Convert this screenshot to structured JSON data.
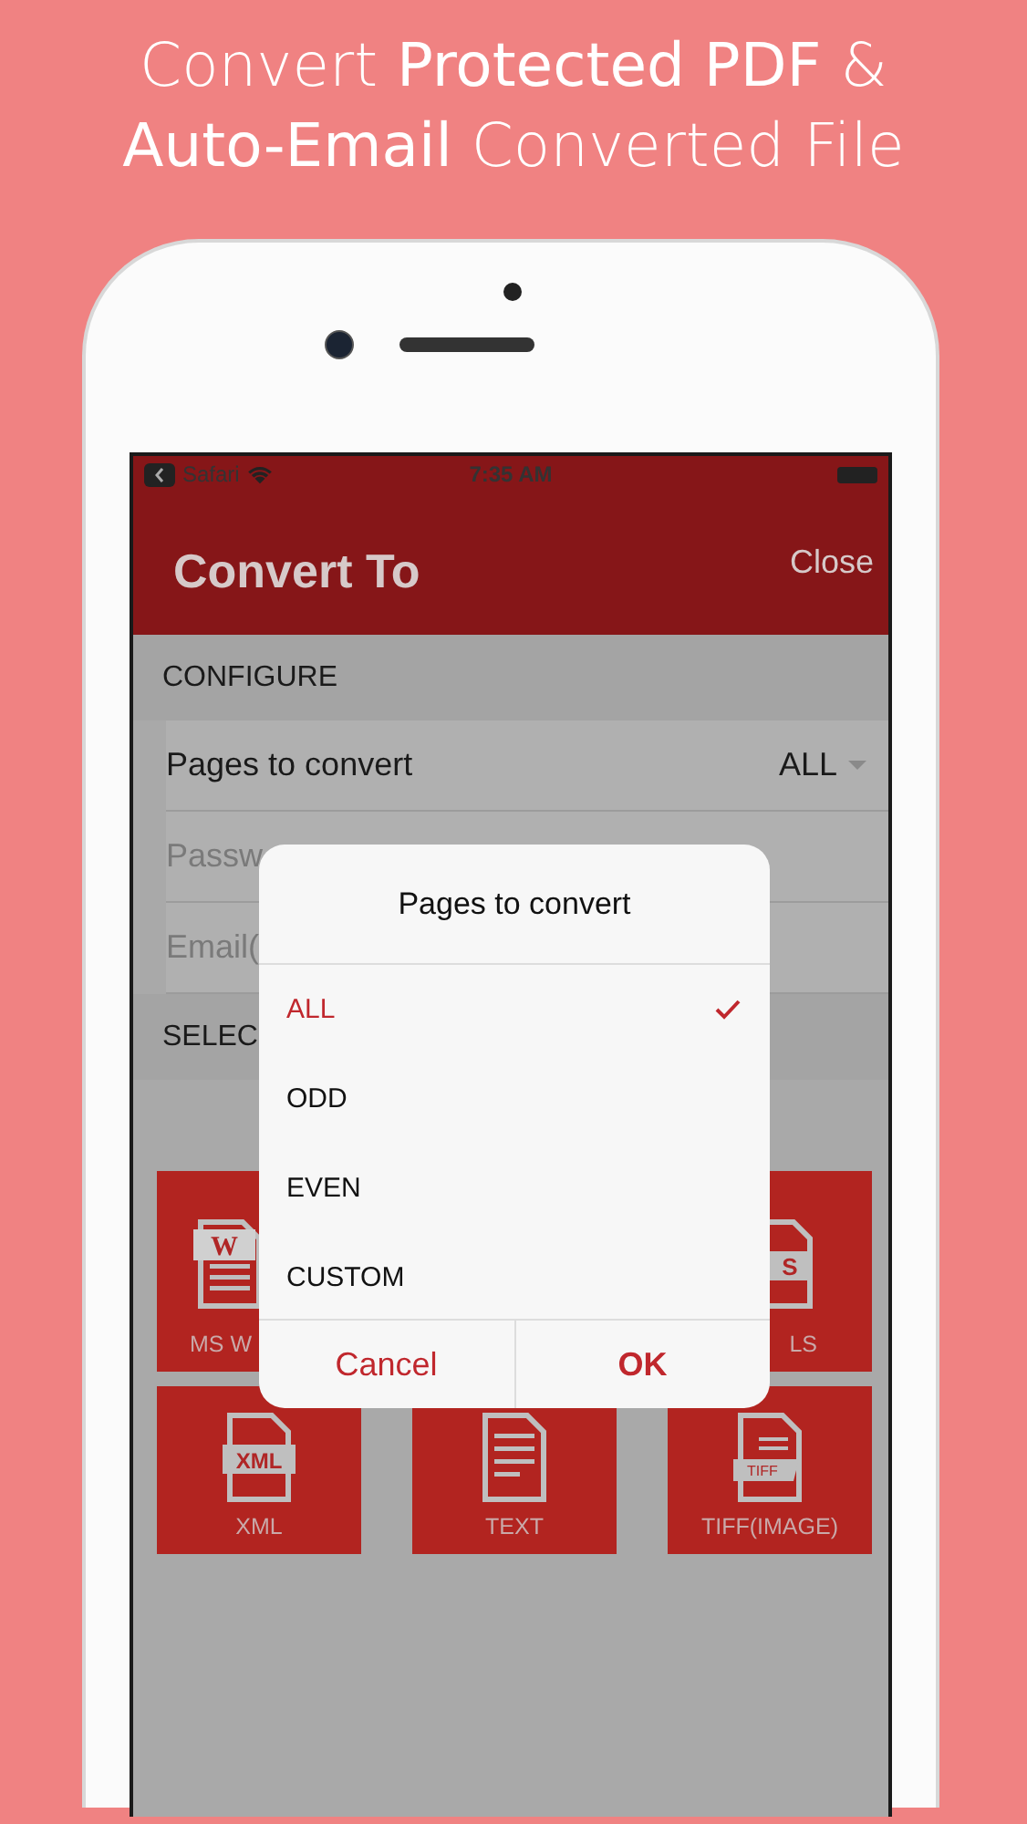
{
  "headline": [
    "Convert **Protected PDF** &",
    "**Auto-Email** Converted File"
  ],
  "status_bar": {
    "back_label": "Safari",
    "time": "7:35 AM"
  },
  "nav": {
    "title": "Convert To",
    "close": "Close"
  },
  "sections": [
    {
      "header": "CONFIGURE",
      "rows": [
        {
          "kind": "select",
          "label": "Pages to convert",
          "value": "ALL"
        },
        {
          "kind": "field",
          "placeholder": "Passw"
        },
        {
          "kind": "field",
          "placeholder": "Email("
        }
      ]
    },
    {
      "header": "SELEC"
    }
  ],
  "tiles": [
    {
      "kind": "word",
      "icon_text": "W",
      "label": "MS W"
    },
    {
      "kind": "xls",
      "icon_text": "S",
      "label": "LS"
    },
    {
      "kind": "xml",
      "icon_text": "XML",
      "label": "XML"
    },
    {
      "kind": "text",
      "label": "TEXT"
    },
    {
      "kind": "tiff",
      "icon_text": "TIFF",
      "label": "TIFF(IMAGE)"
    }
  ],
  "modal": {
    "title": "Pages to convert",
    "options": [
      {
        "label": "ALL",
        "selected": true
      },
      {
        "label": "ODD",
        "selected": false
      },
      {
        "label": "EVEN",
        "selected": false
      },
      {
        "label": "CUSTOM",
        "selected": false
      }
    ],
    "buttons": [
      {
        "label": "Cancel",
        "kind": "cancel"
      },
      {
        "label": "OK",
        "kind": "confirm"
      }
    ]
  }
}
